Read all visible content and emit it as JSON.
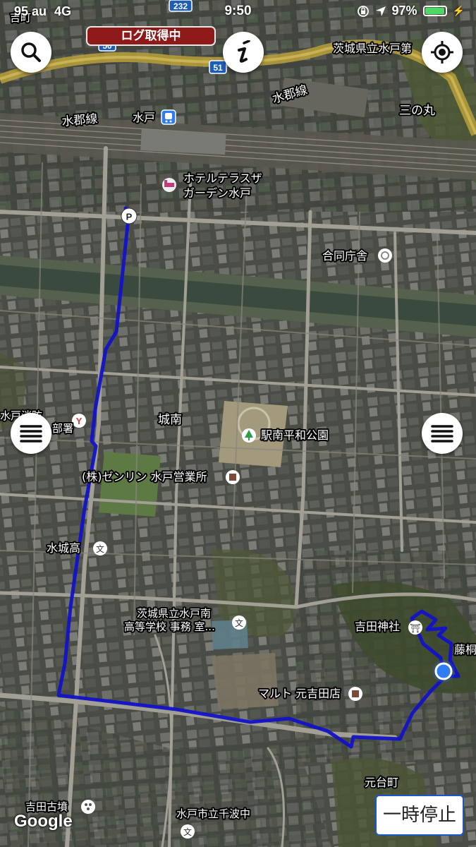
{
  "status_bar": {
    "signal": "95 au",
    "network": "4G",
    "time": "9:50",
    "battery": "97%",
    "battery_level": 0.97
  },
  "log_badge": "ログ取得中",
  "pause_button": "一時停止",
  "attribution": "Google",
  "road_shields": [
    "232",
    "50",
    "51"
  ],
  "labels": {
    "top_left": "吉町",
    "mito_station": "水戸",
    "suigun_left": "水郡線",
    "suigun_right": "水郡線",
    "mito_1st_hs": "茨城県立水戸第",
    "sannomaru": "三の丸",
    "hotel_1": "ホテルテラスザ",
    "hotel_2": "ガーデン水戸",
    "godo": "合同庁舎",
    "fire_1": "水戸消防",
    "fire_2": "部署",
    "jonan": "城南",
    "park": "駅南平和公園",
    "zenrin": "(株)ゼンリン 水戸営業所",
    "suijo": "水城高",
    "minami_1": "茨城県立水戸南",
    "minami_2": "高等学校 事務 室...",
    "yoshida_shrine": "吉田神社",
    "fuji": "藤桐",
    "maruto": "マルト 元吉田店",
    "motodai": "元台町",
    "kofun": "吉田古墳",
    "senba": "水戸市立千波中"
  },
  "colors": {
    "track": "#1212c8",
    "log_badge": "#8e1a1a",
    "location_dot": "#2f7df2",
    "battery": "#4cd964"
  },
  "icons": [
    "search-icon",
    "info-icon",
    "locate-icon",
    "menu-icon",
    "parking-icon",
    "current-location-icon",
    "station-icon",
    "hotel-icon",
    "shrine-icon",
    "school-icon",
    "park-icon"
  ]
}
